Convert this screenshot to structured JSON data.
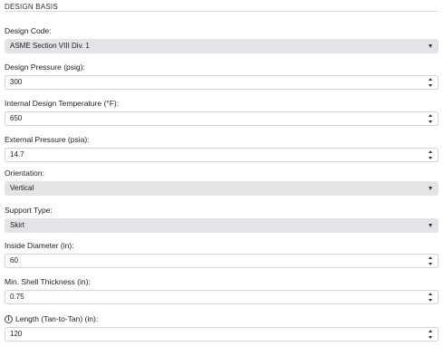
{
  "section": {
    "title": "DESIGN BASIS"
  },
  "fields": {
    "design_code": {
      "label": "Design Code:",
      "value": "ASME Section VIII Div. 1"
    },
    "design_pressure": {
      "label": "Design Pressure (psig):",
      "value": "300"
    },
    "design_temperature": {
      "label": "Internal Design Temperature (°F):",
      "value": "650"
    },
    "external_pressure": {
      "label": "External Pressure (psia):",
      "value": "14.7"
    },
    "orientation": {
      "label": "Orientation:",
      "value": "Vertical"
    },
    "support_type": {
      "label": "Support Type:",
      "value": "Skirt"
    },
    "inside_diameter": {
      "label": "Inside Diameter (in):",
      "value": "60"
    },
    "shell_thickness": {
      "label": "Min. Shell Thickness (in):",
      "value": "0.75"
    },
    "length": {
      "label": "Length (Tan-to-Tan) (in):",
      "value": "120",
      "icon": "info-icon"
    }
  }
}
